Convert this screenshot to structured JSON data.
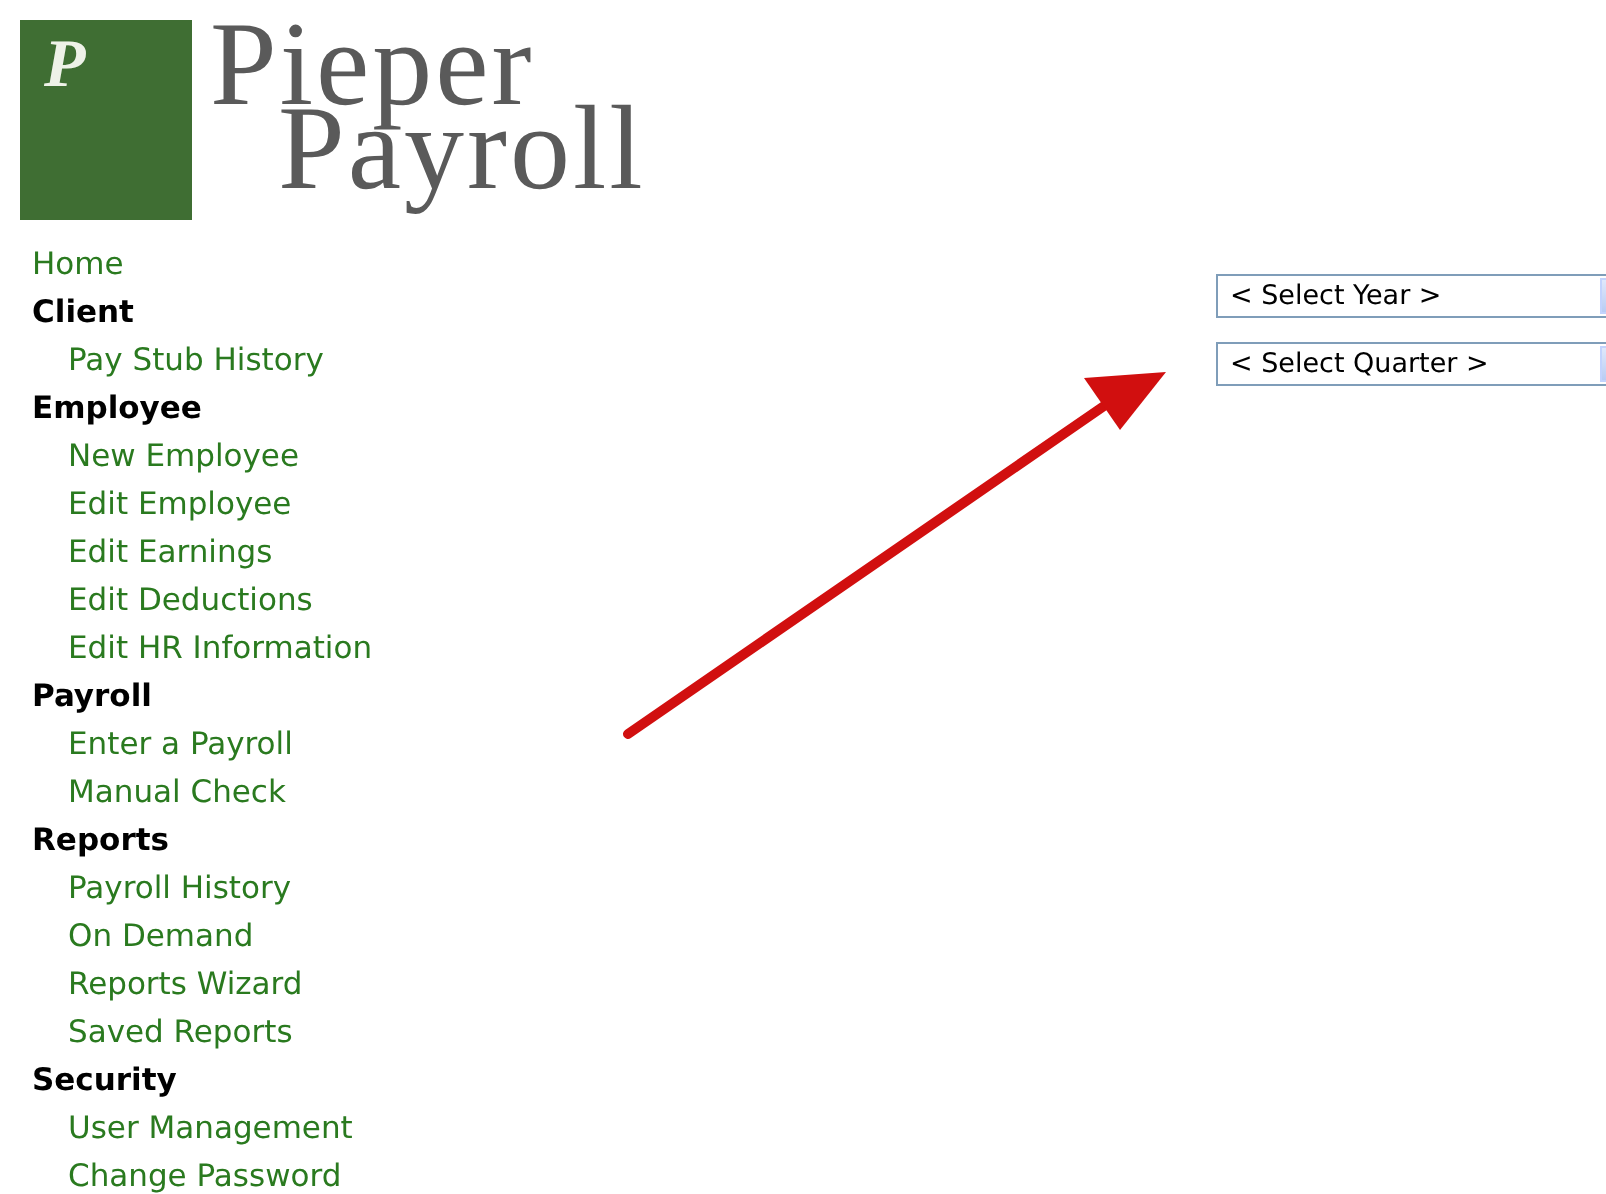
{
  "logo": {
    "letter": "P",
    "line1": "Pieper",
    "line2": "Payroll"
  },
  "nav": [
    {
      "kind": "link",
      "label": "Home"
    },
    {
      "kind": "heading",
      "label": "Client",
      "children": [
        {
          "label": "Pay Stub History"
        }
      ]
    },
    {
      "kind": "heading",
      "label": "Employee",
      "children": [
        {
          "label": "New Employee"
        },
        {
          "label": "Edit Employee"
        },
        {
          "label": "Edit Earnings"
        },
        {
          "label": "Edit Deductions"
        },
        {
          "label": "Edit HR Information"
        }
      ]
    },
    {
      "kind": "heading",
      "label": "Payroll",
      "children": [
        {
          "label": "Enter a Payroll"
        },
        {
          "label": "Manual Check"
        }
      ]
    },
    {
      "kind": "heading",
      "label": "Reports",
      "children": [
        {
          "label": "Payroll History"
        },
        {
          "label": "On Demand"
        },
        {
          "label": "Reports Wizard"
        },
        {
          "label": "Saved Reports"
        }
      ]
    },
    {
      "kind": "heading",
      "label": "Security",
      "children": [
        {
          "label": "User Management"
        },
        {
          "label": "Change Password"
        }
      ]
    }
  ],
  "selects": [
    {
      "value": "< Select Year >"
    },
    {
      "value": "< Select Quarter >"
    }
  ]
}
